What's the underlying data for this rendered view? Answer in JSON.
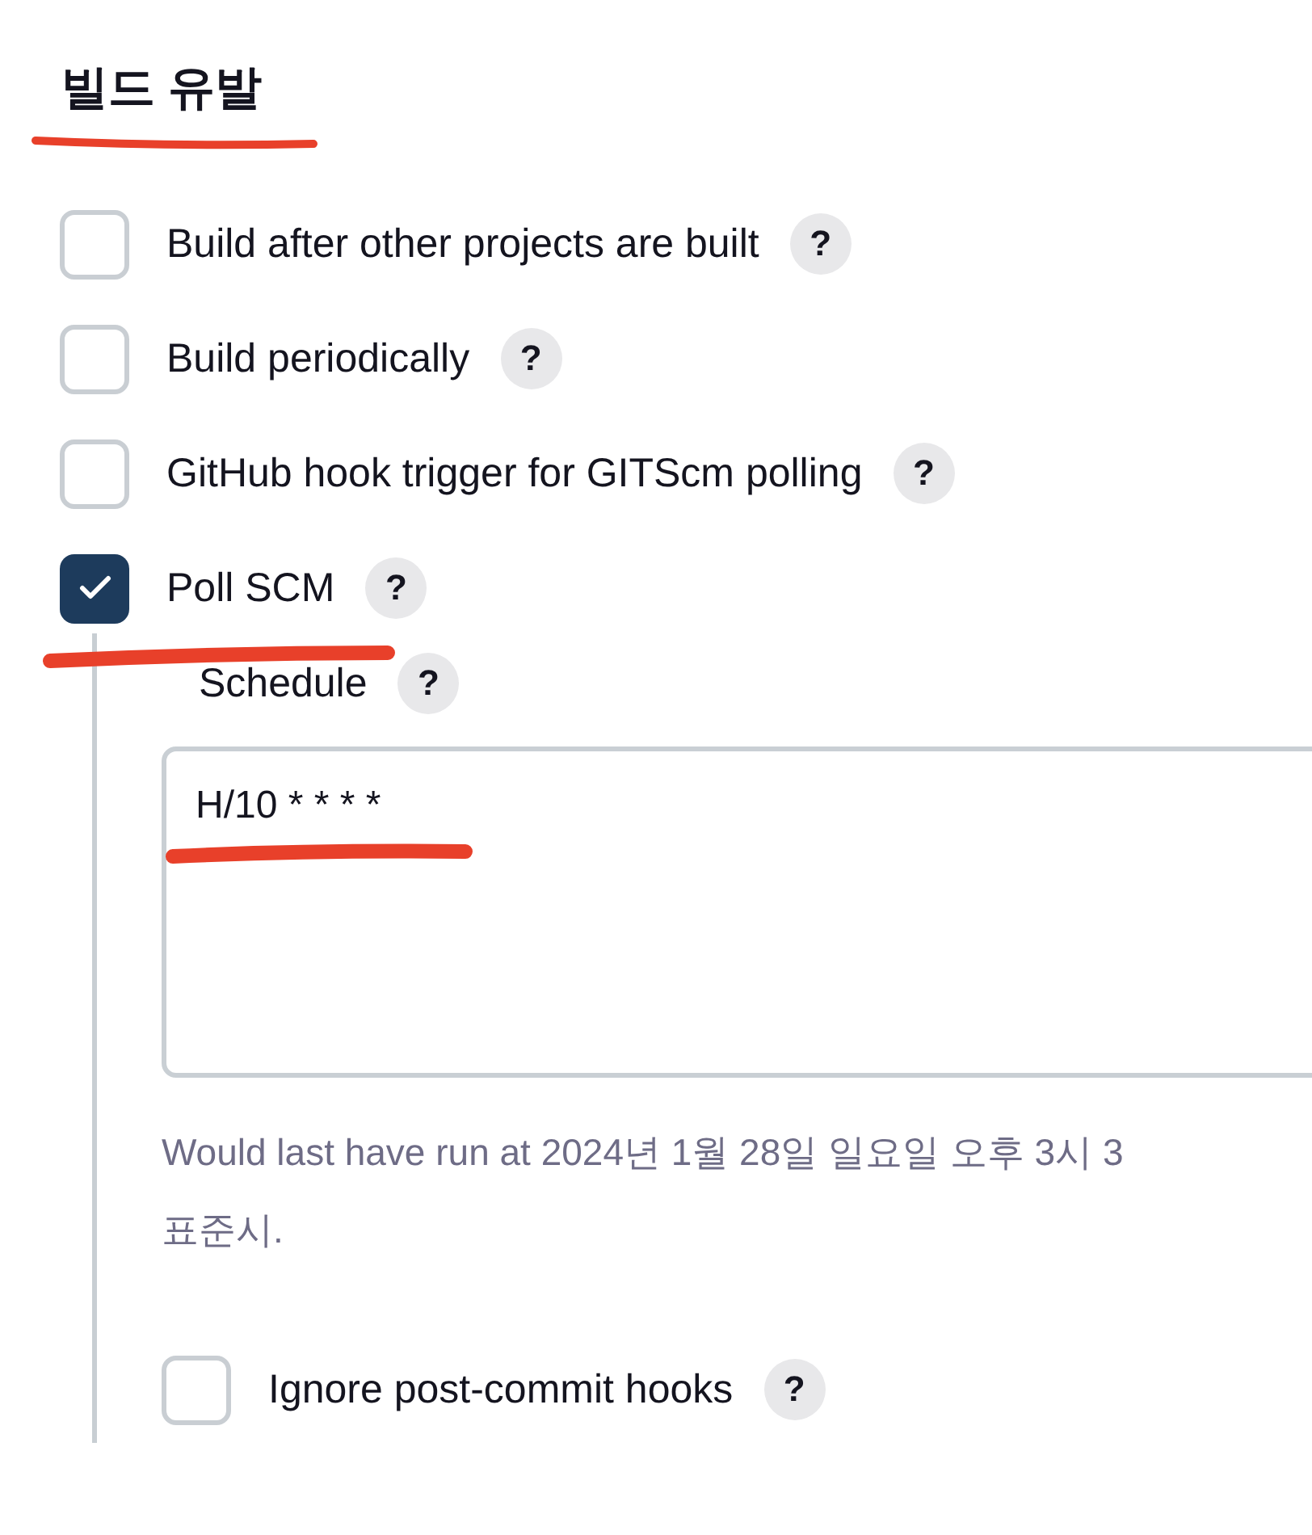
{
  "section": {
    "title": "빌드 유발"
  },
  "triggers": [
    {
      "label": "Build after other projects are built",
      "checked": false,
      "help": "?"
    },
    {
      "label": "Build periodically",
      "checked": false,
      "help": "?"
    },
    {
      "label": "GitHub hook trigger for GITScm polling",
      "checked": false,
      "help": "?"
    },
    {
      "label": "Poll SCM",
      "checked": true,
      "help": "?",
      "options": {
        "schedule_label": "Schedule",
        "schedule_help": "?",
        "schedule_value": "H/10 * * * *",
        "hint_lines": [
          "Would last have run at 2024년 1월 28일 일요일 오후 3시 3",
          "표준시."
        ],
        "ignore_hooks": {
          "label": "Ignore post-commit hooks",
          "checked": false,
          "help": "?"
        }
      }
    }
  ]
}
